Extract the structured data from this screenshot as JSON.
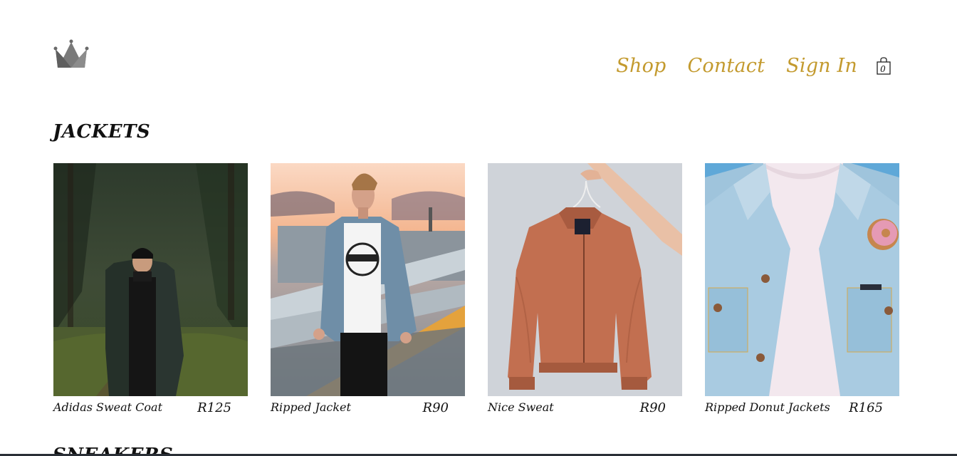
{
  "brand": {
    "logo_icon": "crown-icon"
  },
  "nav": {
    "items": [
      {
        "label": "Shop"
      },
      {
        "label": "Contact"
      },
      {
        "label": "Sign In"
      }
    ],
    "cart": {
      "icon": "shopping-bag-icon",
      "count": "0"
    }
  },
  "sections": [
    {
      "title": "JACKETS",
      "products": [
        {
          "name": "Adidas Sweat Coat",
          "price": "R125"
        },
        {
          "name": "Ripped Jacket",
          "price": "R90"
        },
        {
          "name": "Nice Sweat",
          "price": "R90"
        },
        {
          "name": "Ripped Donut Jackets",
          "price": "R165"
        }
      ]
    },
    {
      "title": "SNEAKERS"
    }
  ],
  "colors": {
    "accent": "#c39a2e",
    "text": "#111111"
  }
}
